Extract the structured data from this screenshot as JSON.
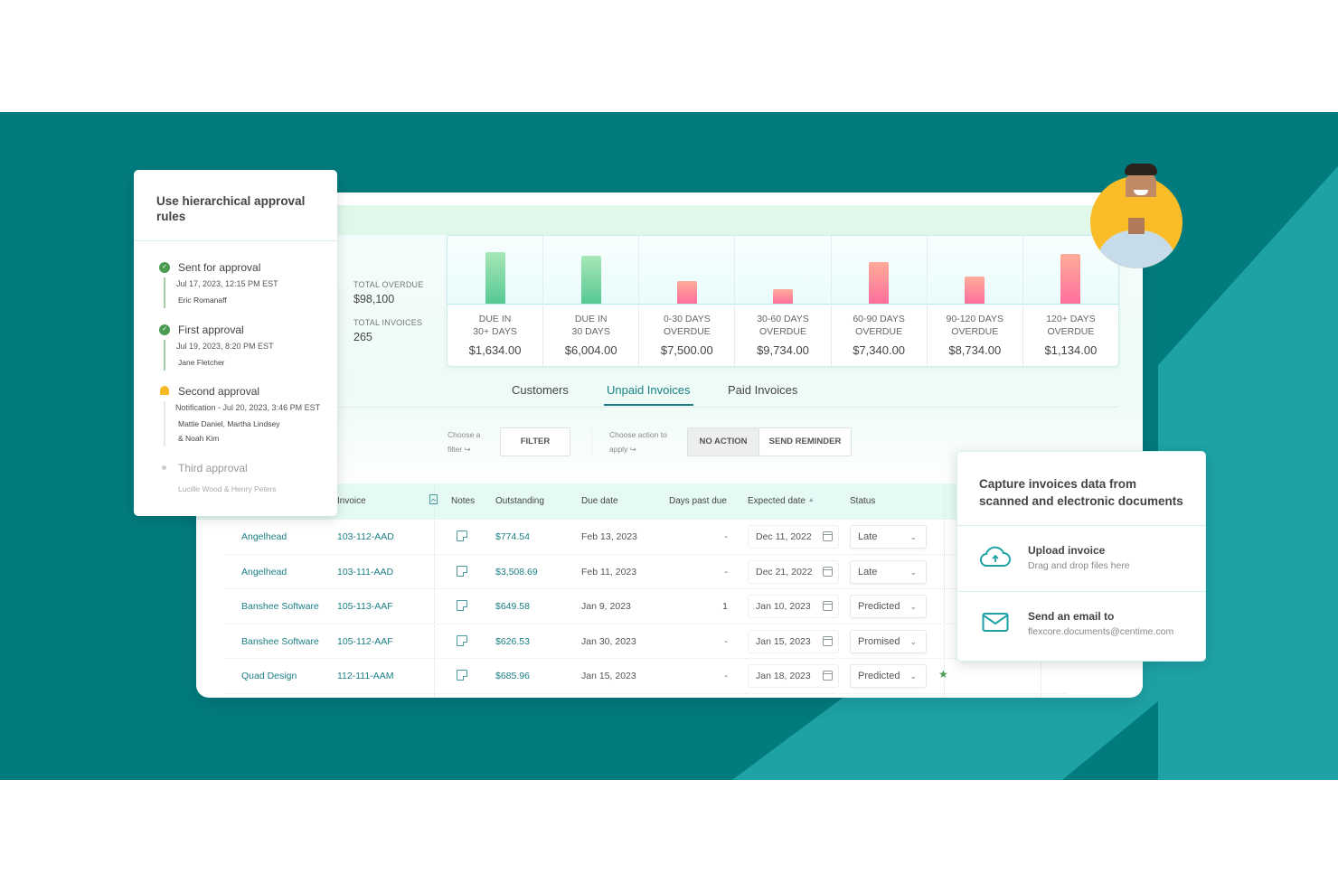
{
  "colors": {
    "brand_teal": "#027b7e",
    "accent_teal": "#1ea2a6",
    "link_teal": "#1a7f85",
    "approved_green": "#4c9a52",
    "pending_yellow": "#f7b924",
    "avatar_yellow": "#fbbd27",
    "bar_green": "#56c892",
    "bar_pink": "#ff6f9c"
  },
  "approval_card": {
    "title": "Use hierarchical approval rules",
    "steps": [
      {
        "name": "Sent for approval",
        "date": "Jul 17, 2023, 12:15 PM EST",
        "people": "Eric Romanaff",
        "state": "done",
        "icon": "check-circle-icon"
      },
      {
        "name": "First approval",
        "date": "Jul 19, 2023, 8:20 PM EST",
        "people": "Jane Fletcher",
        "state": "done",
        "icon": "check-circle-icon"
      },
      {
        "name": "Second approval",
        "date": "Notification - Jul 20, 2023, 3:46 PM EST",
        "people_line1": "Mattie Daniel, Martha Lindsey",
        "people_line2": "& Noah Kim",
        "state": "pending",
        "icon": "bell-icon"
      },
      {
        "name": "Third approval",
        "people": "Lucille Wood & Henry Peters",
        "state": "upcoming",
        "icon": "dot-icon"
      }
    ]
  },
  "summary": {
    "total_overdue_label": "TOTAL OVERDUE",
    "total_overdue_value": "$98,100",
    "total_invoices_label": "TOTAL INVOICES",
    "total_invoices_value": "265"
  },
  "buckets": [
    {
      "line1": "DUE IN",
      "line2": "30+ DAYS",
      "amount": "$1,634.00",
      "bar_value": 1634,
      "bar_level": 0.92,
      "tone": "green"
    },
    {
      "line1": "DUE IN",
      "line2": "30 DAYS",
      "amount": "$6,004.00",
      "bar_value": 6004,
      "bar_level": 0.85,
      "tone": "green"
    },
    {
      "line1": "0-30 DAYS",
      "line2": "OVERDUE",
      "amount": "$7,500.00",
      "bar_value": 7500,
      "bar_level": 0.4,
      "tone": "pink"
    },
    {
      "line1": "30-60 DAYS",
      "line2": "OVERDUE",
      "amount": "$9,734.00",
      "bar_value": 9734,
      "bar_level": 0.26,
      "tone": "pink"
    },
    {
      "line1": "60-90 DAYS",
      "line2": "OVERDUE",
      "amount": "$7,340.00",
      "bar_value": 7340,
      "bar_level": 0.74,
      "tone": "pink"
    },
    {
      "line1": "90-120 DAYS",
      "line2": "OVERDUE",
      "amount": "$8,734.00",
      "bar_value": 8734,
      "bar_level": 0.48,
      "tone": "pink"
    },
    {
      "line1": "120+ DAYS",
      "line2": "OVERDUE",
      "amount": "$1,134.00",
      "bar_value": 1134,
      "bar_level": 0.88,
      "tone": "pink"
    }
  ],
  "tabs": [
    {
      "label": "Customers",
      "active": false
    },
    {
      "label": "Unpaid Invoices",
      "active": true
    },
    {
      "label": "Paid Invoices",
      "active": false
    }
  ],
  "toolbar": {
    "filter_hint_line1": "Choose a",
    "filter_hint_line2": "filter ↪",
    "filter_label": "FILTER",
    "action_hint_line1": "Choose action to",
    "action_hint_line2": "apply ↪",
    "no_action_label": "NO ACTION",
    "send_reminder_label": "SEND REMINDER"
  },
  "table": {
    "columns": {
      "invoice": "Invoice",
      "notes": "Notes",
      "outstanding": "Outstanding",
      "due_date": "Due date",
      "days_past_due": "Days past due",
      "expected_date": "Expected date",
      "status": "Status"
    },
    "rows": [
      {
        "customer": "Angelhead",
        "invoice": "103-112-AAD",
        "outstanding": "$774.54",
        "due_date": "Feb 13, 2023",
        "days_past_due": "-",
        "expected_date": "Dec 11, 2022",
        "status": "Late",
        "starred": false
      },
      {
        "customer": "Angelhead",
        "invoice": "103-111-AAD",
        "outstanding": "$3,508.69",
        "due_date": "Feb 11, 2023",
        "days_past_due": "-",
        "expected_date": "Dec 21, 2022",
        "status": "Late",
        "starred": false
      },
      {
        "customer": "Banshee Software",
        "invoice": "105-113-AAF",
        "outstanding": "$649.58",
        "due_date": "Jan 9, 2023",
        "days_past_due": "1",
        "expected_date": "Jan 10, 2023",
        "status": "Predicted",
        "starred": false
      },
      {
        "customer": "Banshee Software",
        "invoice": "105-112-AAF",
        "outstanding": "$626.53",
        "due_date": "Jan 30, 2023",
        "days_past_due": "-",
        "expected_date": "Jan 15, 2023",
        "status": "Promised",
        "starred": false
      },
      {
        "customer": "Quad Design",
        "invoice": "112-111-AAM",
        "outstanding": "$685.96",
        "due_date": "Jan 15, 2023",
        "days_past_due": "-",
        "expected_date": "Jan 18, 2023",
        "status": "Predicted",
        "starred": true
      }
    ]
  },
  "capture_card": {
    "title_line1": "Capture invoices data from",
    "title_line2": "scanned and electronic documents",
    "upload_title": "Upload invoice",
    "upload_sub": "Drag and drop files here",
    "email_title": "Send an email to",
    "email_address": "flexcore.documents@centime.com"
  }
}
